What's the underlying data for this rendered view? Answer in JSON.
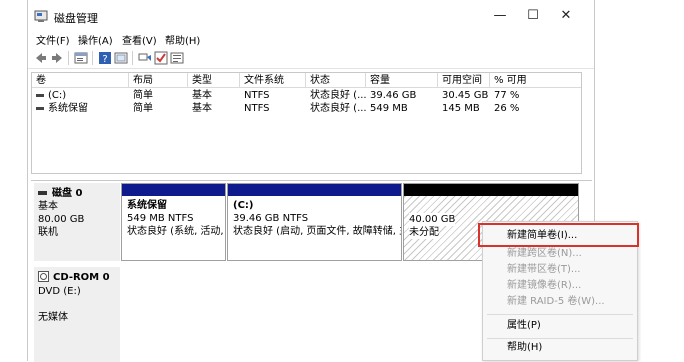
{
  "window": {
    "title": "磁盘管理",
    "minimize": "—",
    "maximize": "☐",
    "close": "✕"
  },
  "menubar": {
    "items": [
      "文件(F)",
      "操作(A)",
      "查看(V)",
      "帮助(H)"
    ]
  },
  "toolbar": {
    "icons": [
      "back-icon",
      "forward-icon",
      "properties-icon",
      "help-icon",
      "refresh-icon",
      "rescan-icon",
      "check-icon",
      "settings-icon"
    ]
  },
  "volume_table": {
    "headers": [
      "卷",
      "布局",
      "类型",
      "文件系统",
      "状态",
      "容量",
      "可用空间",
      "% 可用"
    ],
    "rows": [
      [
        "(C:)",
        "简单",
        "基本",
        "NTFS",
        "状态良好 (...",
        "39.46 GB",
        "30.45 GB",
        "77 %"
      ],
      [
        "系统保留",
        "简单",
        "基本",
        "NTFS",
        "状态良好 (...",
        "549 MB",
        "145 MB",
        "26 %"
      ]
    ]
  },
  "disks": [
    {
      "name": "磁盘 0",
      "type": "基本",
      "size": "80.00 GB",
      "status": "联机",
      "partitions": [
        {
          "name": "系统保留",
          "detail": "549 MB NTFS",
          "status": "状态良好 (系统, 活动, 主"
        },
        {
          "name": "(C:)",
          "detail": "39.46 GB NTFS",
          "status": "状态良好 (启动, 页面文件, 故障转储, 主分"
        },
        {
          "name": "",
          "detail": "40.00 GB",
          "status": "未分配"
        }
      ]
    },
    {
      "name": "CD-ROM 0",
      "type": "DVD (E:)",
      "status": "无媒体"
    }
  ],
  "context_menu": {
    "items": [
      {
        "label": "新建简单卷(I)...",
        "enabled": true
      },
      {
        "label": "新建跨区卷(N)...",
        "enabled": false
      },
      {
        "label": "新建带区卷(T)...",
        "enabled": false
      },
      {
        "label": "新建镜像卷(R)...",
        "enabled": false
      },
      {
        "label": "新建 RAID-5 卷(W)...",
        "enabled": false
      },
      {
        "label": "属性(P)",
        "enabled": true
      },
      {
        "label": "帮助(H)",
        "enabled": true
      }
    ]
  },
  "colors": {
    "partition_bar": "#0f1a8c",
    "unallocated_bar": "#000000",
    "highlight": "#d9312b"
  }
}
